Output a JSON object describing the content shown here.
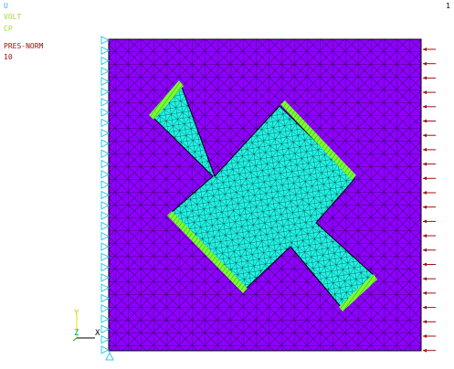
{
  "legend": {
    "items": [
      {
        "label": "U",
        "color": "#3fa7ff"
      },
      {
        "label": "VOLT",
        "color": "#a3d83a"
      },
      {
        "label": "CP",
        "color": "#a3d83a"
      },
      {
        "label": "PRES-NORM",
        "color": "#a01010"
      },
      {
        "label": "10",
        "color": "#a01010"
      }
    ]
  },
  "triad": {
    "y_label": "Y",
    "z_label": "Z",
    "x_label": "X"
  },
  "corner_mark": "1",
  "colors": {
    "background": "#ffffff",
    "plate": "#8e00ff",
    "cross": "#22f2e4",
    "mesh": "#000000",
    "constraint": "#36c9e8",
    "pressure": "#a01010",
    "electrode": "#7cff30"
  },
  "model": {
    "boundary_conditions": {
      "left_edge": "U",
      "right_edge": "PRES-NORM",
      "electrode_edges": "VOLT"
    }
  }
}
